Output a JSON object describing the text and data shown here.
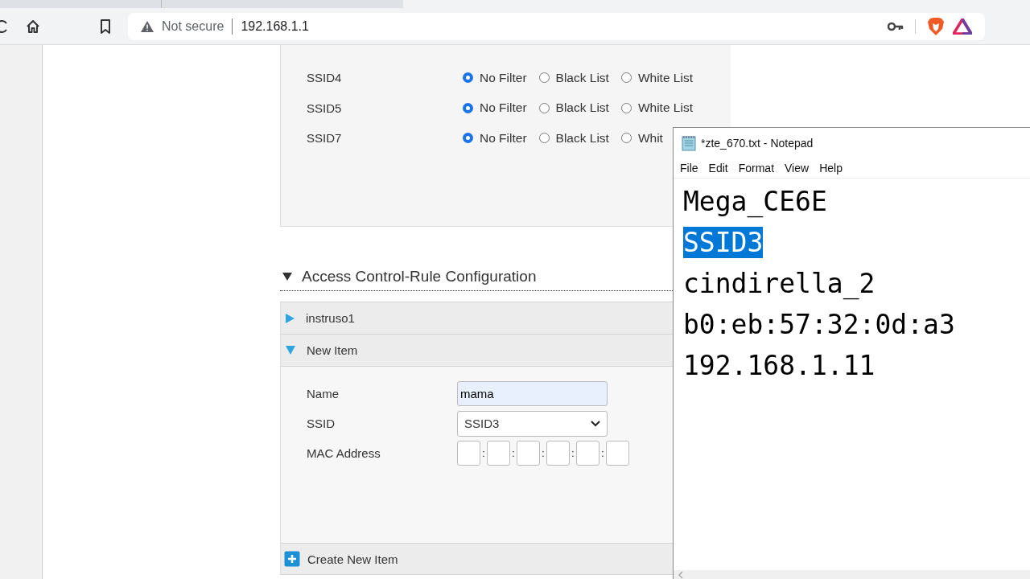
{
  "browser": {
    "security": "Not secure",
    "url": "192.168.1.1"
  },
  "filter_rows": [
    {
      "ssid": "SSID4",
      "options": [
        {
          "label": "No Filter",
          "selected": true
        },
        {
          "label": "Black List",
          "selected": false
        },
        {
          "label": "White List",
          "selected": false
        }
      ]
    },
    {
      "ssid": "SSID5",
      "options": [
        {
          "label": "No Filter",
          "selected": true
        },
        {
          "label": "Black List",
          "selected": false
        },
        {
          "label": "White List",
          "selected": false
        }
      ]
    },
    {
      "ssid": "SSID7",
      "options": [
        {
          "label": "No Filter",
          "selected": true
        },
        {
          "label": "Black List",
          "selected": false
        },
        {
          "label": "Whit",
          "selected": false
        }
      ]
    }
  ],
  "section": {
    "title": "Access Control-Rule Configuration",
    "expanded": true
  },
  "rules": [
    {
      "name": "instruso1",
      "expanded": false
    },
    {
      "name": "New Item",
      "expanded": true
    }
  ],
  "form": {
    "name_label": "Name",
    "name_value": "mama",
    "ssid_label": "SSID",
    "ssid_value": "SSID3",
    "mac_label": "MAC Address",
    "separator": ":"
  },
  "create_label": "Create New Item",
  "notepad": {
    "title": "*zte_670.txt - Notepad",
    "menu": [
      "File",
      "Edit",
      "Format",
      "View",
      "Help"
    ],
    "lines": [
      {
        "text": "Mega_CE6E",
        "selected": false
      },
      {
        "text": "SSID3",
        "selected": true
      },
      {
        "text": "cindirella_2",
        "selected": false
      },
      {
        "text": "b0:eb:57:32:0d:a3",
        "selected": false
      },
      {
        "text": "192.168.1.11",
        "selected": false
      }
    ]
  }
}
